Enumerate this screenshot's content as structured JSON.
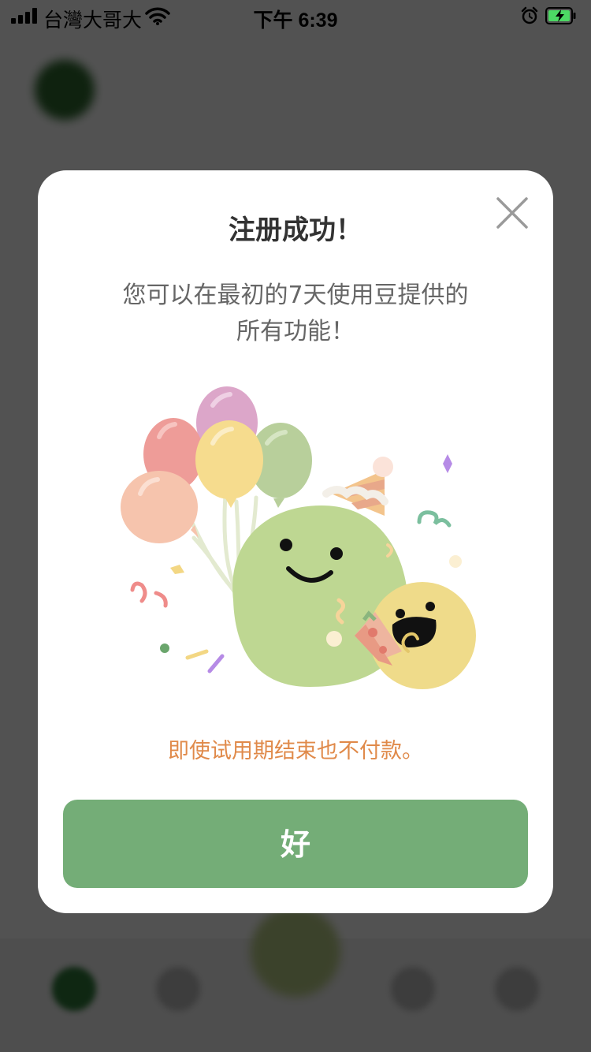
{
  "status_bar": {
    "carrier": "台灣大哥大",
    "time": "下午 6:39",
    "signal_icon": "cellular-signal-icon",
    "wifi_icon": "wifi-icon",
    "alarm_icon": "alarm-icon",
    "battery_icon": "battery-charging-icon",
    "battery_color": "#4cd964"
  },
  "modal": {
    "title": "注册成功！",
    "message_line1": "您可以在最初的7天使用豆提供的",
    "message_line2": "所有功能！",
    "note": "即使试用期结束也不付款。",
    "ok_label": "好",
    "close_icon": "close-icon",
    "illustration": "celebration-balloons-illustration"
  },
  "colors": {
    "accent_green": "#74ad77",
    "note_orange": "#e08a4a",
    "title_text": "#333333",
    "body_text": "#666666"
  }
}
